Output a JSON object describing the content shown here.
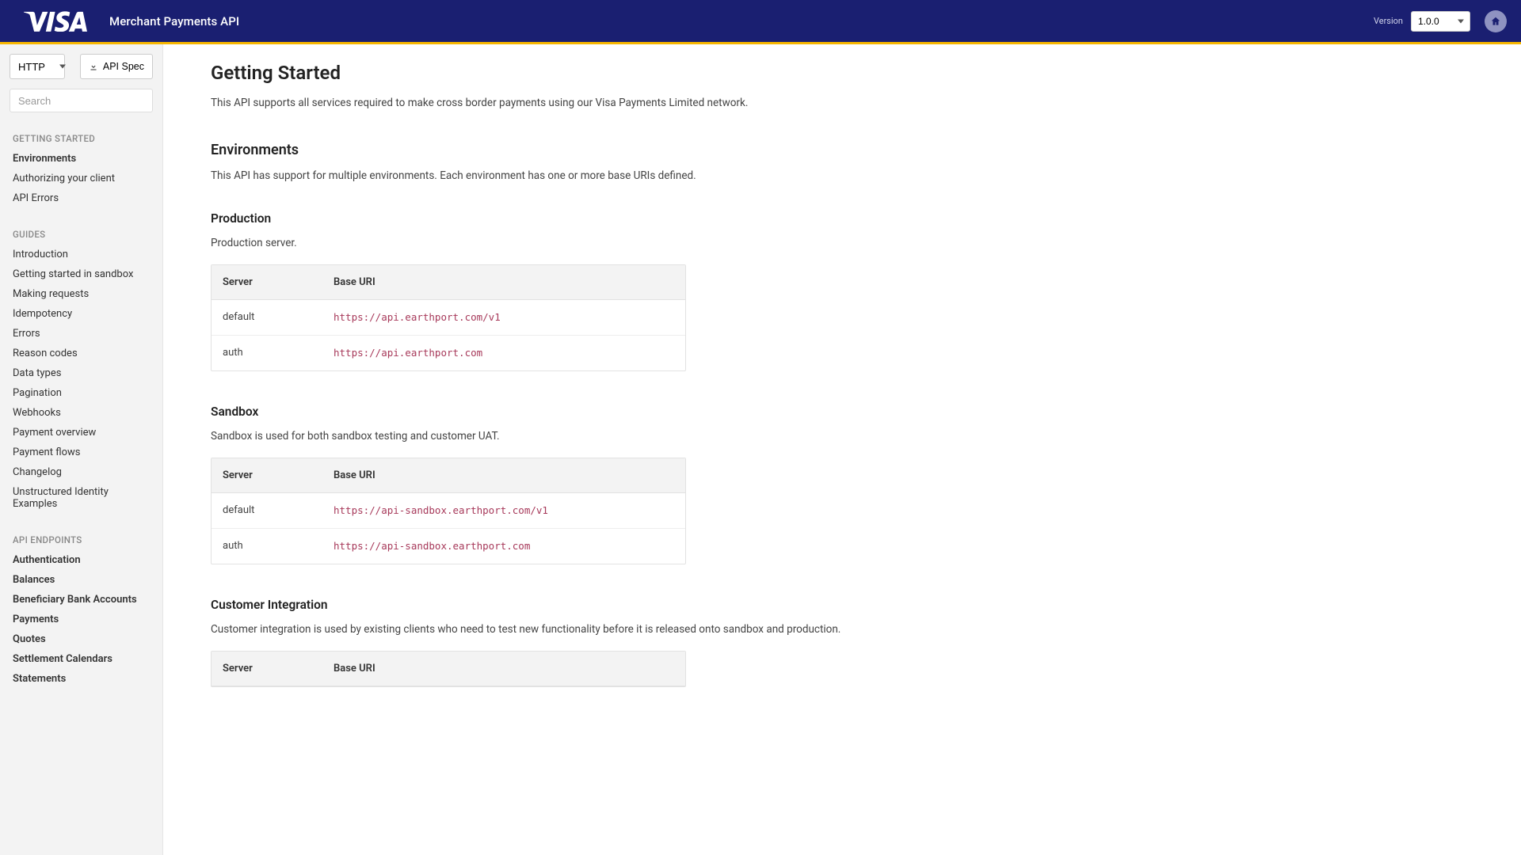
{
  "header": {
    "brand": "VISA",
    "title": "Merchant Payments API",
    "version_label": "Version",
    "version_value": "1.0.0"
  },
  "sidebar": {
    "protocol_value": "HTTP",
    "api_spec_label": "API Spec",
    "search_placeholder": "Search",
    "sections": [
      {
        "title": "Getting Started",
        "items": [
          {
            "label": "Environments",
            "bold": true
          },
          {
            "label": "Authorizing your client",
            "bold": false
          },
          {
            "label": "API Errors",
            "bold": false
          }
        ]
      },
      {
        "title": "Guides",
        "items": [
          {
            "label": "Introduction",
            "bold": false
          },
          {
            "label": "Getting started in sandbox",
            "bold": false
          },
          {
            "label": "Making requests",
            "bold": false
          },
          {
            "label": "Idempotency",
            "bold": false
          },
          {
            "label": "Errors",
            "bold": false
          },
          {
            "label": "Reason codes",
            "bold": false
          },
          {
            "label": "Data types",
            "bold": false
          },
          {
            "label": "Pagination",
            "bold": false
          },
          {
            "label": "Webhooks",
            "bold": false
          },
          {
            "label": "Payment overview",
            "bold": false
          },
          {
            "label": "Payment flows",
            "bold": false
          },
          {
            "label": "Changelog",
            "bold": false
          },
          {
            "label": "Unstructured Identity Examples",
            "bold": false
          }
        ]
      },
      {
        "title": "API Endpoints",
        "items": [
          {
            "label": "Authentication",
            "bold": true
          },
          {
            "label": "Balances",
            "bold": true
          },
          {
            "label": "Beneficiary Bank Accounts",
            "bold": true
          },
          {
            "label": "Payments",
            "bold": true
          },
          {
            "label": "Quotes",
            "bold": true
          },
          {
            "label": "Settlement Calendars",
            "bold": true
          },
          {
            "label": "Statements",
            "bold": true
          }
        ]
      }
    ]
  },
  "content": {
    "title": "Getting Started",
    "intro": "This API supports all services required to make cross border payments using our Visa Payments Limited network.",
    "env_heading": "Environments",
    "env_text": "This API has support for multiple environments. Each environment has one or more base URIs defined.",
    "table_headers": {
      "server": "Server",
      "base_uri": "Base URI"
    },
    "environments": [
      {
        "name": "Production",
        "desc": "Production server.",
        "rows": [
          {
            "server": "default",
            "uri": "https://api.earthport.com/v1"
          },
          {
            "server": "auth",
            "uri": "https://api.earthport.com"
          }
        ]
      },
      {
        "name": "Sandbox",
        "desc": "Sandbox is used for both sandbox testing and customer UAT.",
        "rows": [
          {
            "server": "default",
            "uri": "https://api-sandbox.earthport.com/v1"
          },
          {
            "server": "auth",
            "uri": "https://api-sandbox.earthport.com"
          }
        ]
      },
      {
        "name": "Customer Integration",
        "desc": "Customer integration is used by existing clients who need to test new functionality before it is released onto sandbox and production.",
        "rows": []
      }
    ]
  }
}
